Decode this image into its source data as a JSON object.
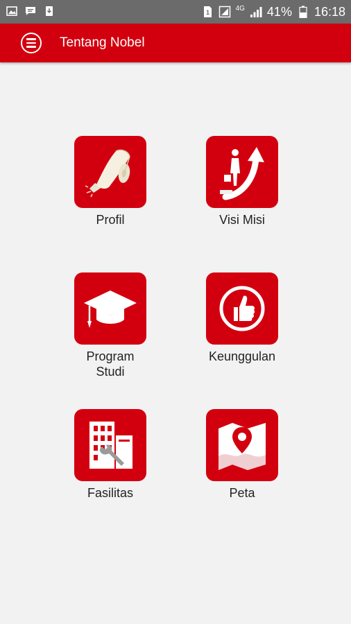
{
  "status_bar": {
    "battery_percent": "41%",
    "time": "16:18",
    "network": "4G"
  },
  "app_bar": {
    "title": "Tentang Nobel",
    "menu_icon": "menu-icon"
  },
  "menu_tiles": [
    {
      "label": "Profil",
      "icon": "scroll-icon"
    },
    {
      "label": "Visi Misi",
      "icon": "growth-arrow-icon"
    },
    {
      "label": "Program\nStudi",
      "icon": "graduation-cap-icon"
    },
    {
      "label": "Keunggulan",
      "icon": "thumbs-up-icon"
    },
    {
      "label": "Fasilitas",
      "icon": "building-wrench-icon"
    },
    {
      "label": "Peta",
      "icon": "map-pin-icon"
    }
  ],
  "colors": {
    "primary": "#d2000f",
    "status_bar": "#6b6b6b",
    "background": "#f2f2f2"
  }
}
